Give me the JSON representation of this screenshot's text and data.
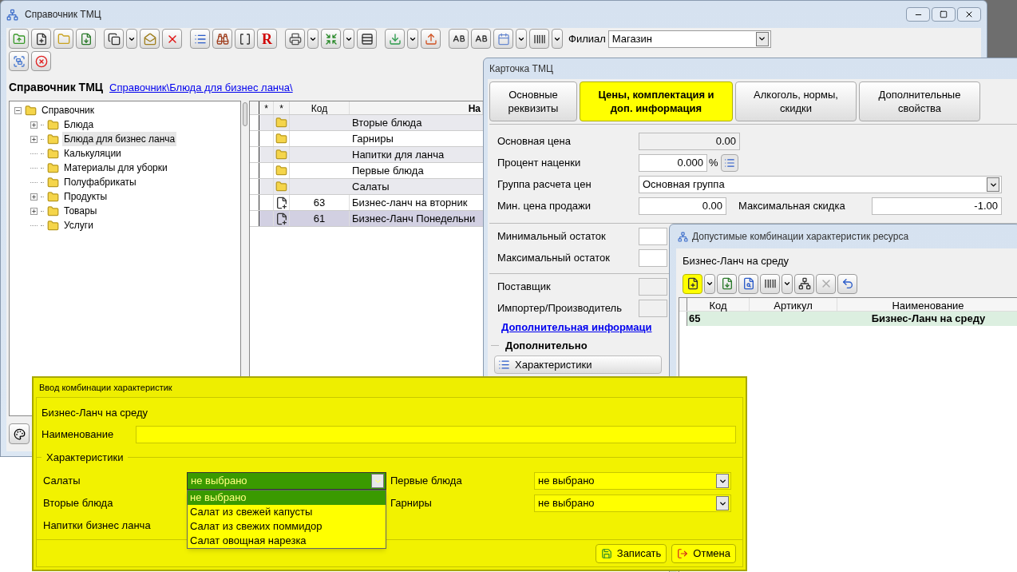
{
  "main_window": {
    "title": "Справочник ТМЦ",
    "report_glyph": "R",
    "branch_label": "Филиал",
    "branch_value": "Магазин"
  },
  "breadcrumb": {
    "title": "Справочник ТМЦ",
    "path": "Справочник\\Блюда для бизнес ланча\\"
  },
  "tree": {
    "label": "Справочник",
    "expanded": true,
    "children": [
      {
        "label": "Блюда",
        "expandable": true,
        "selected": false
      },
      {
        "label": "Блюда для бизнес ланча",
        "expandable": true,
        "selected": true
      },
      {
        "label": "Калькуляции",
        "expandable": false,
        "selected": false
      },
      {
        "label": "Материалы для уборки",
        "expandable": false,
        "selected": false
      },
      {
        "label": "Полуфабрикаты",
        "expandable": false,
        "selected": false
      },
      {
        "label": "Продукты",
        "expandable": true,
        "selected": false
      },
      {
        "label": "Товары",
        "expandable": true,
        "selected": false
      },
      {
        "label": "Услуги",
        "expandable": false,
        "selected": false
      }
    ]
  },
  "table": {
    "columns": [
      "*",
      "*",
      "Код",
      "На"
    ],
    "rows": [
      {
        "kind": "folder",
        "code": "",
        "name": "Вторые блюда",
        "selected": false
      },
      {
        "kind": "folder",
        "code": "",
        "name": "Гарниры",
        "selected": false
      },
      {
        "kind": "folder",
        "code": "",
        "name": "Напитки для ланча",
        "selected": false
      },
      {
        "kind": "folder",
        "code": "",
        "name": "Первые блюда",
        "selected": false
      },
      {
        "kind": "folder",
        "code": "",
        "name": "Салаты",
        "selected": false
      },
      {
        "kind": "item",
        "code": "63",
        "name": "Бизнес-ланч на вторник",
        "selected": false
      },
      {
        "kind": "item",
        "code": "61",
        "name": "Бизнес-Ланч Понедельни",
        "selected": true
      }
    ]
  },
  "card": {
    "title": "Карточка ТМЦ",
    "tabs": [
      {
        "label": "Основные реквизиты",
        "selected": false
      },
      {
        "label": "Цены, комплектация и доп.  информация",
        "selected": true
      },
      {
        "label": "Алкоголь, нормы, скидки",
        "selected": false
      },
      {
        "label": "Дополнительные свойства",
        "selected": false
      }
    ],
    "base_price": {
      "label": "Основная цена",
      "value": "0.00"
    },
    "markup": {
      "label": "Процент наценки",
      "value": "0.000",
      "unit": "%"
    },
    "price_group": {
      "label": "Группа расчета цен",
      "value": "Основная группа"
    },
    "min_price": {
      "label": "Мин. цена продажи",
      "value": "0.00"
    },
    "max_discount": {
      "label": "Максимальная скидка",
      "value": "-1.00"
    },
    "min_stock": {
      "label": "Минимальный остаток"
    },
    "max_stock": {
      "label": "Максимальный остаток"
    },
    "supplier": {
      "label": "Поставщик"
    },
    "importer": {
      "label": "Импортер/Производитель"
    },
    "link": "Дополнительная информаци",
    "section": "Дополнительно",
    "characteristics_button": "Характеристики"
  },
  "combinations": {
    "title": "Допустимые комбинации характеристик ресурса",
    "subtitle": "Бизнес-Ланч на среду",
    "columns": [
      "Код",
      "Артикул",
      "Наименование"
    ],
    "rows": [
      {
        "code": "65",
        "article": "",
        "name": "Бизнес-Ланч на среду",
        "selected": true
      }
    ]
  },
  "dialog": {
    "title": "Ввод комбинации характеристик",
    "subtitle": "Бизнес-Ланч на среду",
    "name_label": "Наименование",
    "group": "Характеристики",
    "fields": [
      {
        "label": "Салаты",
        "value": "не выбрано",
        "open": true
      },
      {
        "label": "Первые блюда",
        "value": "не выбрано",
        "open": false
      },
      {
        "label": "Вторые блюда",
        "open": false
      },
      {
        "label": "Гарниры",
        "value": "не выбрано",
        "open": false
      },
      {
        "label": "Напитки бизнес ланча",
        "open": false
      }
    ],
    "options": [
      {
        "label": "не выбрано",
        "selected": true
      },
      {
        "label": "Салат из свежей капусты",
        "selected": false
      },
      {
        "label": "Салат из свежих поммидор",
        "selected": false
      },
      {
        "label": "Салат овощная нарезка",
        "selected": false
      }
    ],
    "buttons": [
      {
        "kind": "save",
        "label": "Записать"
      },
      {
        "kind": "cancel",
        "label": "Отмена"
      }
    ]
  }
}
